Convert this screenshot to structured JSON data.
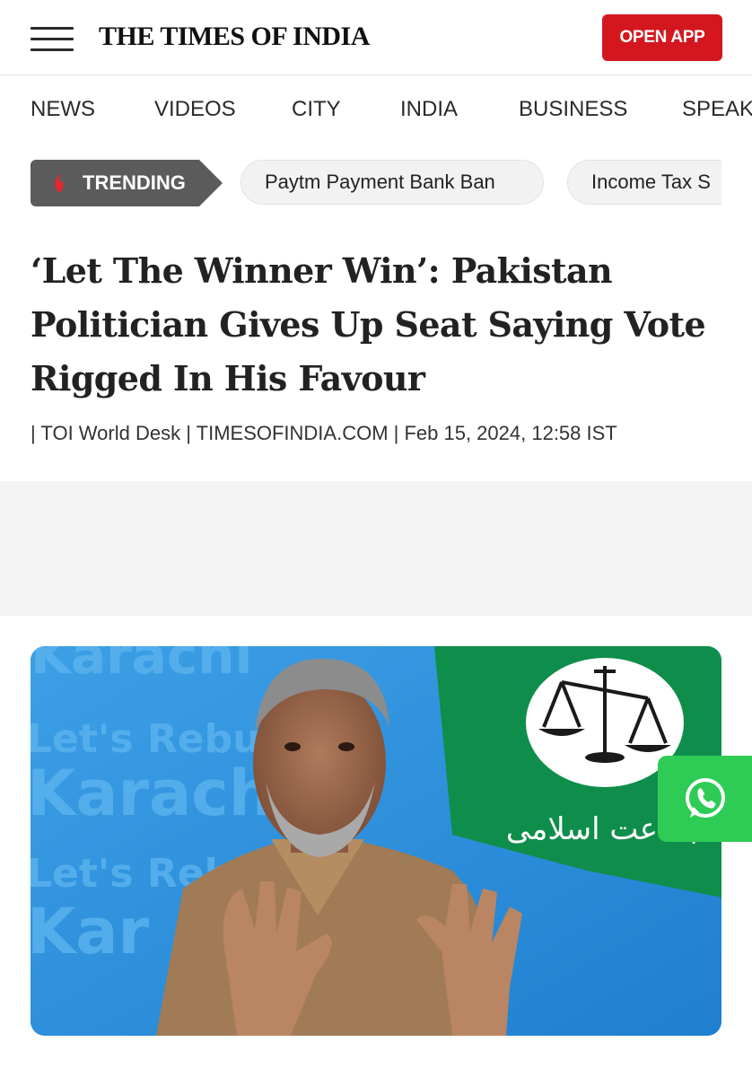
{
  "header": {
    "logo": "THE TIMES OF INDIA",
    "open_app_label": "OPEN APP",
    "menu_icon": "hamburger-menu-icon"
  },
  "nav": {
    "items": [
      "NEWS",
      "VIDEOS",
      "CITY",
      "INDIA",
      "BUSINESS",
      "SPEAK"
    ]
  },
  "trending": {
    "label": "TRENDING",
    "icon": "flame-icon",
    "chips": [
      "Paytm Payment Bank Ban",
      "Income Tax S"
    ]
  },
  "article": {
    "headline": "‘Let The Winner Win’: Pakistan Politician Gives Up Seat Saying Vote Rigged In His Favour",
    "byline": "| TOI World Desk | TIMESOFINDIA.COM | Feb 15, 2024, 12:58 IST"
  },
  "hero_image": {
    "backdrop_text": [
      "Karachi",
      "Let's Rebuild",
      "Karachi",
      "Let's Reb",
      "Kar"
    ],
    "flag_text": "جماعت اسلامی"
  },
  "floating": {
    "whatsapp_icon": "whatsapp-icon"
  },
  "colors": {
    "brand_red": "#d4171e",
    "trending_gray": "#5b5b5b",
    "whatsapp_green": "#2ecc55"
  }
}
